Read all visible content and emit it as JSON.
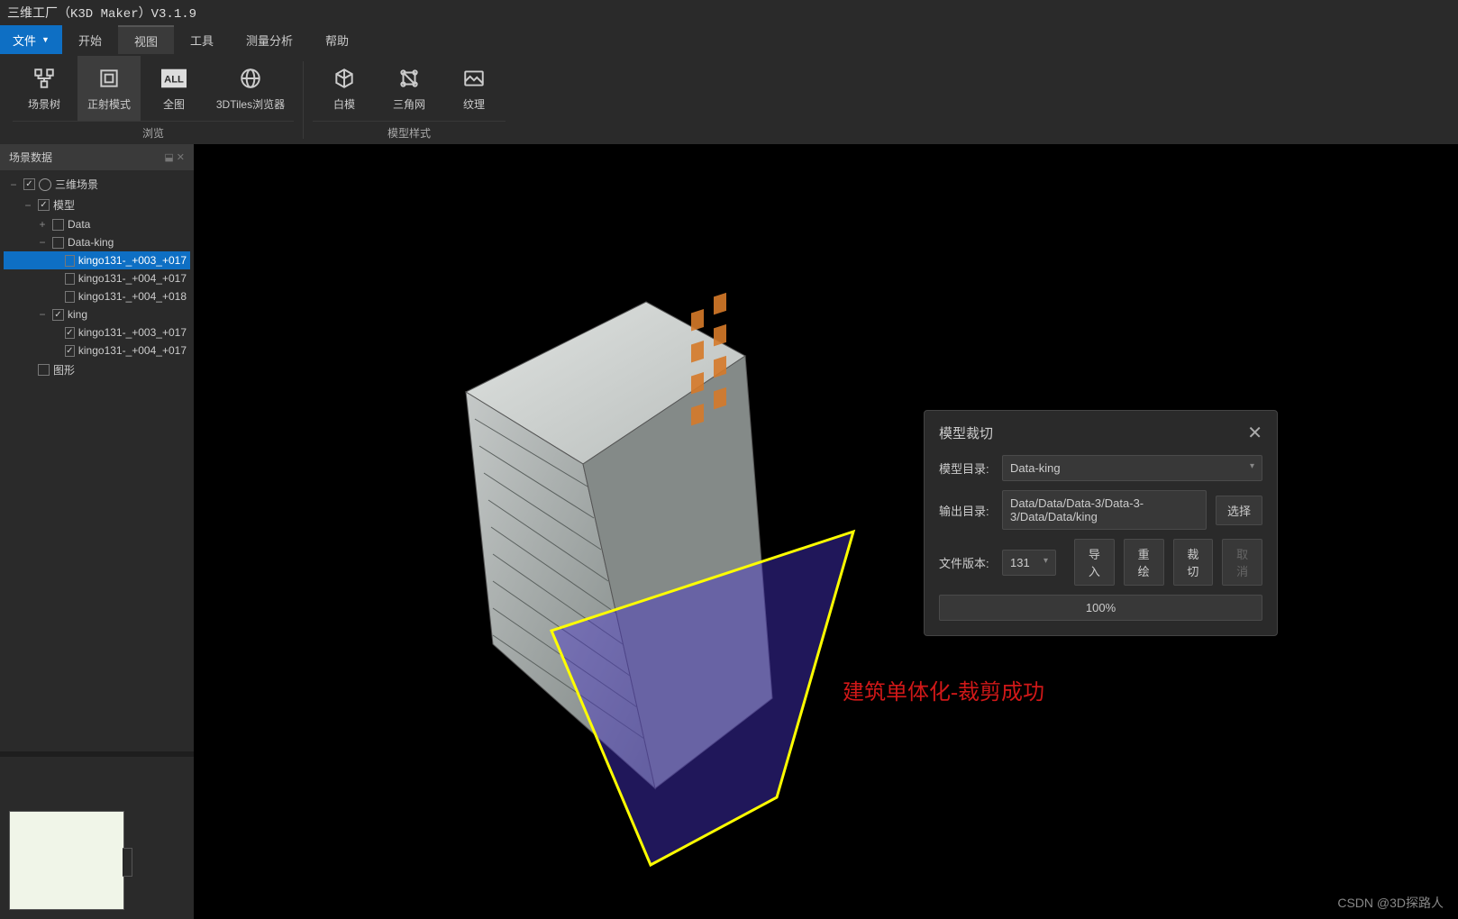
{
  "title": "三维工厂（K3D Maker）V3.1.9",
  "menu": {
    "file": "文件",
    "items": [
      "开始",
      "视图",
      "工具",
      "测量分析",
      "帮助"
    ],
    "active": 1
  },
  "ribbon": {
    "browse_group": "浏览",
    "model_style_group": "模型样式",
    "scene_tree": "场景树",
    "ortho_mode": "正射模式",
    "full_view": "全图",
    "tiles_browser": "3DTiles浏览器",
    "white_model": "白模",
    "triangle_mesh": "三角网",
    "texture": "纹理"
  },
  "scene_panel": {
    "title": "场景数据",
    "root": "三维场景",
    "model": "模型",
    "data": "Data",
    "data_king": "Data-king",
    "items_dk": [
      "kingo131-_+003_+017",
      "kingo131-_+004_+017",
      "kingo131-_+004_+018"
    ],
    "king": "king",
    "items_king": [
      "kingo131-_+003_+017",
      "kingo131-_+004_+017"
    ],
    "graphics": "图形"
  },
  "dialog": {
    "title": "模型裁切",
    "model_dir_label": "模型目录:",
    "model_dir_value": "Data-king",
    "output_dir_label": "输出目录:",
    "output_dir_value": "Data/Data/Data-3/Data-3-3/Data/Data/king",
    "select_btn": "选择",
    "file_version_label": "文件版本:",
    "file_version_value": "131",
    "import_btn": "导入",
    "redraw_btn": "重绘",
    "crop_btn": "裁切",
    "cancel_btn": "取消",
    "progress": "100%"
  },
  "annotation": "建筑单体化-裁剪成功",
  "watermark": "CSDN @3D探路人"
}
